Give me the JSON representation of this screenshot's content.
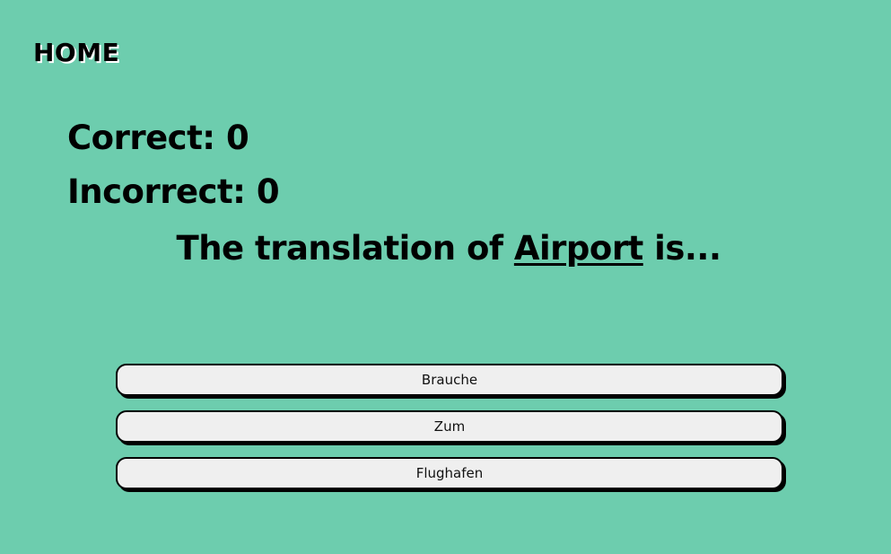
{
  "nav": {
    "home_label": "HOME"
  },
  "score": {
    "correct_label": "Correct: 0",
    "incorrect_label": "Incorrect: 0"
  },
  "question": {
    "prefix": "The translation of ",
    "word": "Airport",
    "suffix": " is..."
  },
  "options": [
    {
      "label": "Brauche"
    },
    {
      "label": "Zum"
    },
    {
      "label": "Flughafen"
    }
  ],
  "colors": {
    "background": "#6dcdae",
    "button_background": "#efefef",
    "text": "#000000"
  }
}
